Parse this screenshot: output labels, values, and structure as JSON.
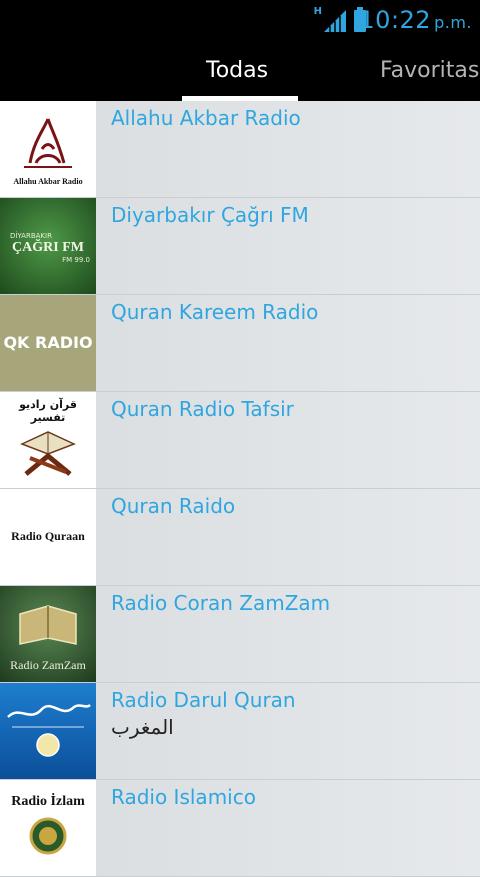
{
  "status_bar": {
    "time": "10:22",
    "ampm": "p.m.",
    "network": "H"
  },
  "tabs": [
    {
      "label": "Todas",
      "selected": true
    },
    {
      "label": "Favoritas",
      "selected": false
    }
  ],
  "stations": [
    {
      "name": "Allahu Akbar Radio",
      "logo_text": "Allahu Akbar Radio"
    },
    {
      "name": "Diyarbakır Çağrı FM",
      "logo_lines": [
        "DİYARBAKIR",
        "ÇAĞRI FM",
        "FM 99.0"
      ]
    },
    {
      "name": "Quran Kareem Radio",
      "logo_text": "QK RADIO"
    },
    {
      "name": "Quran Radio Tafsir",
      "logo_text": "قرآن راديو تفسير"
    },
    {
      "name": "Quran Raido",
      "logo_text": "Radio Quraan"
    },
    {
      "name": "Radio Coran ZamZam",
      "logo_text": "Radio ZamZam"
    },
    {
      "name": "Radio Darul Quran",
      "subtitle": "المغرب"
    },
    {
      "name": "Radio Islamico",
      "logo_text": "Radio İzlam"
    }
  ],
  "colors": {
    "accent": "#2fa6df",
    "bar": "#000000",
    "row_bg": "#dfe3e6"
  }
}
